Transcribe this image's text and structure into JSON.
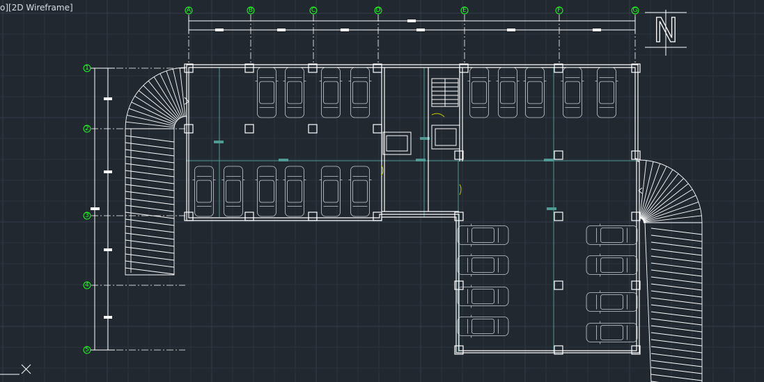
{
  "viewport": {
    "view_label": "o][2D Wireframe]",
    "background_color": "#212830",
    "grid_color": "#2a3340"
  },
  "drawing": {
    "grid_column_labels": [
      "A",
      "B",
      "C",
      "D",
      "E",
      "F",
      "G"
    ],
    "grid_row_labels": [
      "1",
      "2",
      "3",
      "4",
      "5"
    ],
    "north_arrow_letter": "N",
    "colors": {
      "wall_lines": "#ffffff",
      "grid_bubbles": "#22ff22",
      "beam_lines": "#4f9a94",
      "door_swing": "#c8c800"
    }
  }
}
